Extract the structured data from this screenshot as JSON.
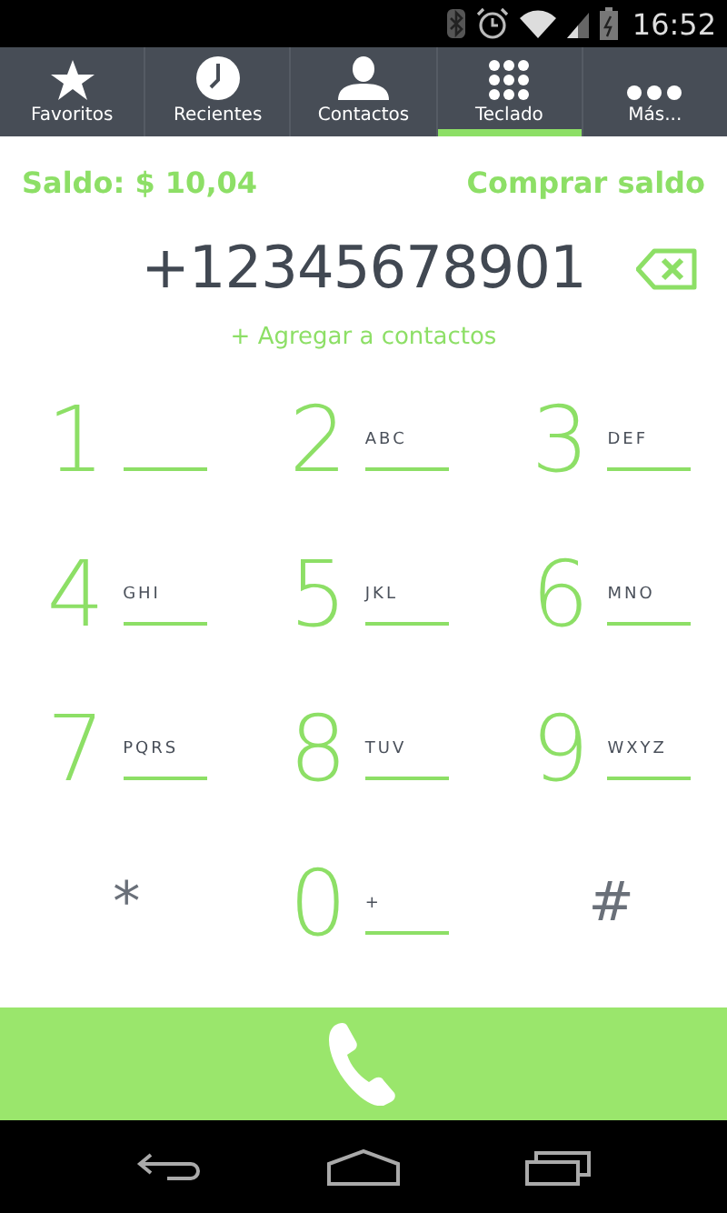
{
  "status_bar": {
    "time": "16:52"
  },
  "tabs": [
    {
      "label": "Favoritos",
      "kind": "star",
      "selected": false
    },
    {
      "label": "Recientes",
      "kind": "clock",
      "selected": false
    },
    {
      "label": "Contactos",
      "kind": "person",
      "selected": false
    },
    {
      "label": "Teclado",
      "kind": "grid",
      "selected": true
    },
    {
      "label": "Más...",
      "kind": "dots",
      "selected": false
    }
  ],
  "balance": {
    "label": "Saldo: $ 10,04",
    "buy_link": "Comprar saldo"
  },
  "number": {
    "value": "+12345678901"
  },
  "add_contact": "+ Agregar a contactos",
  "keys": [
    {
      "kind": "digit",
      "digit": "1"
    },
    {
      "kind": "digit",
      "digit": "2",
      "letters": "ABC"
    },
    {
      "kind": "digit",
      "digit": "3",
      "letters": "DEF"
    },
    {
      "kind": "digit",
      "digit": "4",
      "letters": "GHI"
    },
    {
      "kind": "digit",
      "digit": "5",
      "letters": "JKL"
    },
    {
      "kind": "digit",
      "digit": "6",
      "letters": "MNO"
    },
    {
      "kind": "digit",
      "digit": "7",
      "letters": "PQRS"
    },
    {
      "kind": "digit",
      "digit": "8",
      "letters": "TUV"
    },
    {
      "kind": "digit",
      "digit": "9",
      "letters": "WXYZ"
    },
    {
      "kind": "symbol",
      "digit": "*"
    },
    {
      "kind": "digit",
      "digit": "0",
      "letters": "+"
    },
    {
      "kind": "symbol",
      "digit": "#"
    }
  ]
}
